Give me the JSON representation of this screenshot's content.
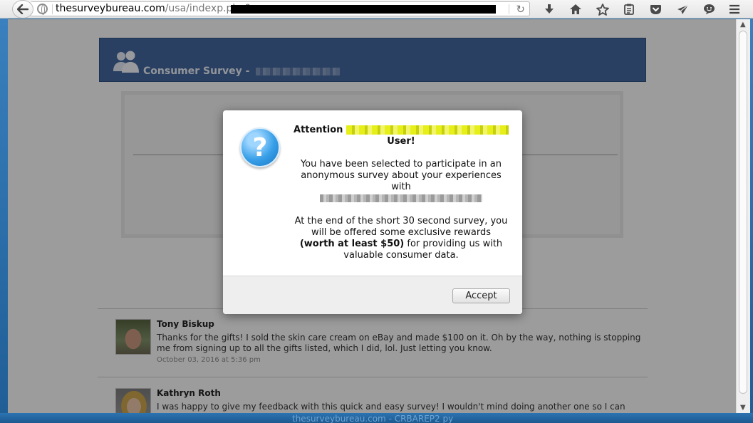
{
  "browser": {
    "url_domain": "thesurveybureau.com",
    "url_path": "/usa/indexp.php?"
  },
  "page": {
    "header_title": "Consumer Survey - "
  },
  "modal": {
    "attention": "Attention",
    "user": "User!",
    "p1": "You have been selected to participate in an anonymous survey about your experiences with",
    "p2_start": "At the end of the short 30 second survey, you will be offered some exclusive rewards",
    "p2_bold": "(worth at least $50)",
    "p2_end": "for providing us with valuable consumer data.",
    "accept_label": "Accept"
  },
  "comments": [
    {
      "name": "Tony Biskup",
      "text": "Thanks for the gifts! I sold the skin care cream on eBay and made $100 on it. Oh by the way, nothing is stopping me from signing up to all the gifts listed, which I did, lol. Just letting you know.",
      "date": "October 03, 2016 at 5:36 pm"
    },
    {
      "name": "Kathryn Roth",
      "text": "I was happy to give my feedback with this quick and easy survey! I wouldn't mind doing another one so I can get more"
    }
  ],
  "taskbar": {
    "title": "thesurveybureau.com - CRBAREP2 py"
  }
}
